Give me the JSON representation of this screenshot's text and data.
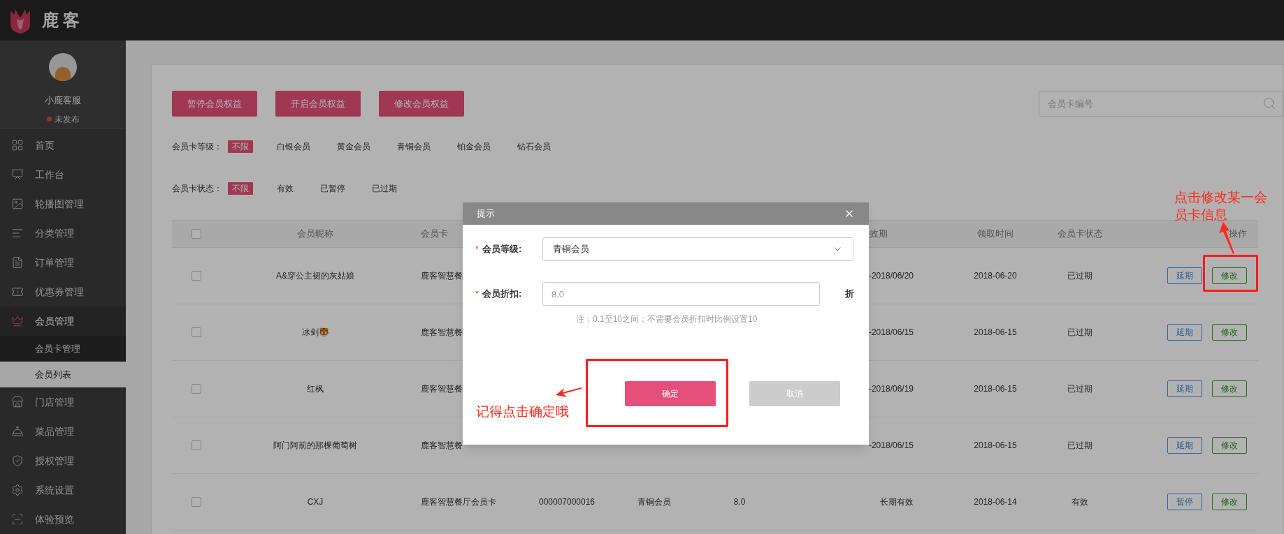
{
  "brand": {
    "name": "鹿客"
  },
  "profile": {
    "name": "小鹿客服",
    "status": "未发布"
  },
  "sidebar": {
    "items": [
      {
        "label": "首页",
        "selected": false
      },
      {
        "label": "工作台",
        "selected": false
      },
      {
        "label": "轮播图管理",
        "selected": false
      },
      {
        "label": "分类管理",
        "selected": false
      },
      {
        "label": "订单管理",
        "selected": false
      },
      {
        "label": "优惠券管理",
        "selected": false
      },
      {
        "label": "会员管理",
        "selected": true,
        "children": [
          {
            "label": "会员卡管理",
            "selected": false
          },
          {
            "label": "会员列表",
            "selected": true
          }
        ]
      },
      {
        "label": "门店管理",
        "selected": false
      },
      {
        "label": "菜品管理",
        "selected": false
      },
      {
        "label": "授权管理",
        "selected": false
      },
      {
        "label": "系统设置",
        "selected": false
      },
      {
        "label": "体验预览",
        "selected": false
      }
    ]
  },
  "actions": [
    "暂停会员权益",
    "开启会员权益",
    "修改会员权益"
  ],
  "search": {
    "placeholder": "会员卡编号"
  },
  "filters": [
    {
      "label": "会员卡等级：",
      "options": [
        {
          "label": "不限",
          "selected": true
        },
        {
          "label": "白银会员",
          "selected": false
        },
        {
          "label": "黄金会员",
          "selected": false
        },
        {
          "label": "青铜会员",
          "selected": false
        },
        {
          "label": "铂金会员",
          "selected": false
        },
        {
          "label": "钻石会员",
          "selected": false
        }
      ]
    },
    {
      "label": "会员卡状态：",
      "options": [
        {
          "label": "不限",
          "selected": true
        },
        {
          "label": "有效",
          "selected": false
        },
        {
          "label": "已暂停",
          "selected": false
        },
        {
          "label": "已过期",
          "selected": false
        }
      ]
    }
  ],
  "table": {
    "select_all": {
      "checked": false
    },
    "columns": {
      "nickname": "会员昵称",
      "card_name": "会员卡",
      "validity": "效期",
      "claim_time": "领取时间",
      "status": "会员卡状态",
      "actions": "操作"
    },
    "rows": [
      {
        "checked": false,
        "nickname": "A&穿公主裙的灰姑娘",
        "card_name": "鹿客智慧餐",
        "validity": "-2018/06/20",
        "claim_time": "2018-06-20",
        "status": "已过期",
        "actions": [
          {
            "label": "延期",
            "kind": "extend"
          },
          {
            "label": "修改",
            "kind": "edit"
          }
        ]
      },
      {
        "checked": false,
        "nickname": "冰剑🐯",
        "card_name": "鹿客智慧餐",
        "validity": "-2018/06/15",
        "claim_time": "2018-06-15",
        "status": "已过期",
        "actions": [
          {
            "label": "延期",
            "kind": "extend"
          },
          {
            "label": "修改",
            "kind": "edit"
          }
        ]
      },
      {
        "checked": false,
        "nickname": "红枫",
        "card_name": "鹿客智慧餐",
        "validity": "-2018/06/19",
        "claim_time": "2018-06-15",
        "status": "已过期",
        "actions": [
          {
            "label": "延期",
            "kind": "extend"
          },
          {
            "label": "修改",
            "kind": "edit"
          }
        ]
      },
      {
        "checked": false,
        "nickname": "阿门阿前的那棵葡萄树",
        "card_name": "鹿客智慧餐",
        "validity": "-2018/06/15",
        "claim_time": "2018-06-15",
        "status": "已过期",
        "actions": [
          {
            "label": "延期",
            "kind": "extend"
          },
          {
            "label": "修改",
            "kind": "edit"
          }
        ]
      },
      {
        "checked": false,
        "nickname": "CXJ",
        "card_name": "鹿客智慧餐厅会员卡",
        "card_no": "000007000016",
        "level": "青铜会员",
        "discount": "8.0",
        "validity": "长期有效",
        "claim_time": "2018-06-14",
        "status": "有效",
        "actions": [
          {
            "label": "暂停",
            "kind": "pause"
          },
          {
            "label": "修改",
            "kind": "edit"
          }
        ]
      }
    ]
  },
  "dialog": {
    "title": "提示",
    "fields": [
      {
        "kind": "select",
        "required_mark": "*",
        "label": "会员等级:",
        "value": "青铜会员"
      },
      {
        "kind": "input",
        "required_mark": "*",
        "label": "会员折扣:",
        "placeholder": "8.0",
        "suffix": "折"
      }
    ],
    "note": "注：0.1至10之间；不需要会员折扣时比例设置10",
    "buttons": [
      {
        "label": "确定",
        "kind": "primary"
      },
      {
        "label": "取消",
        "kind": "secondary"
      }
    ]
  },
  "annotations": [
    {
      "kind": "edit",
      "text": "点击修改某一会员卡信息"
    },
    {
      "kind": "confirm",
      "text": "记得点击确定哦"
    }
  ]
}
